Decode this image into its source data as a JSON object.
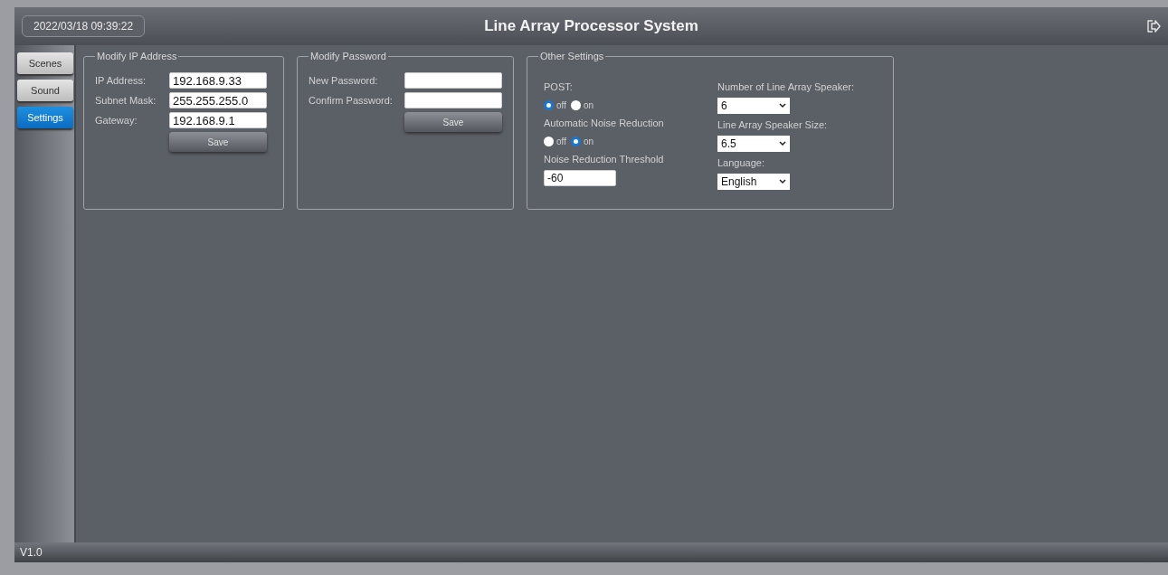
{
  "header": {
    "datetime": "2022/03/18 09:39:22",
    "title": "Line Array Processor System"
  },
  "sidebar": {
    "items": [
      {
        "label": "Scenes",
        "selected": false
      },
      {
        "label": "Sound",
        "selected": false
      },
      {
        "label": "Settings",
        "selected": true
      }
    ]
  },
  "ip_panel": {
    "title": "Modify IP Address",
    "fields": [
      {
        "label": "IP Address:",
        "value": "192.168.9.33"
      },
      {
        "label": "Subnet Mask:",
        "value": "255.255.255.0"
      },
      {
        "label": "Gateway:",
        "value": "192.168.9.1"
      }
    ],
    "button": "Save"
  },
  "password_panel": {
    "title": "Modify Password",
    "fields": [
      {
        "label": "New Password:"
      },
      {
        "label": "Confirm Password:"
      }
    ],
    "button": "Save"
  },
  "other_panel": {
    "title": "Other Settings",
    "left": [
      {
        "kind": "radio",
        "label": "POST:",
        "options": [
          {
            "label": "off",
            "selected": true
          },
          {
            "label": "on",
            "selected": false
          }
        ]
      },
      {
        "kind": "radio",
        "label": "Automatic Noise Reduction",
        "options": [
          {
            "label": "off",
            "selected": false
          },
          {
            "label": "on",
            "selected": true
          }
        ]
      },
      {
        "kind": "input",
        "label": "Noise Reduction Threshold",
        "value": "-60"
      }
    ],
    "right": [
      {
        "kind": "select",
        "label": "Number of Line Array Speaker:",
        "value": "6"
      },
      {
        "kind": "select",
        "label": "Line Array Speaker Size:",
        "value": "6.5"
      },
      {
        "kind": "select",
        "label": "Language:",
        "value": "English"
      }
    ]
  },
  "footer": {
    "version": "V1.0"
  }
}
